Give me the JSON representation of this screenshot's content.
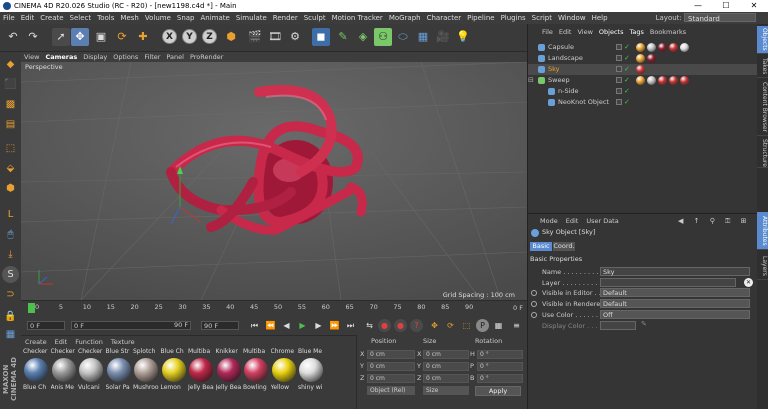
{
  "window": {
    "title": "CINEMA 4D R20.026 Studio (RC - R20) - [new1198.c4d *] - Main",
    "minimize": "—",
    "maximize": "☐",
    "close": "✕"
  },
  "menubar": {
    "items": [
      "File",
      "Edit",
      "Create",
      "Select",
      "Tools",
      "Mesh",
      "Volume",
      "Snap",
      "Animate",
      "Simulate",
      "Render",
      "Sculpt",
      "Motion Tracker",
      "MoGraph",
      "Character",
      "Pipeline",
      "Plugins",
      "Script",
      "Window",
      "Help"
    ],
    "layout_label": "Layout:",
    "layout_value": "Standard"
  },
  "toolbar": {
    "x": "X",
    "y": "Y",
    "z": "Z"
  },
  "viewport": {
    "menu": [
      "View",
      "Cameras",
      "Display",
      "Options",
      "Filter",
      "Panel",
      "ProRender"
    ],
    "camera_label": "Perspective",
    "grid_spacing": "Grid Spacing : 100 cm"
  },
  "timeline": {
    "ticks": [
      "0",
      "5",
      "10",
      "15",
      "20",
      "25",
      "30",
      "35",
      "40",
      "45",
      "50",
      "55",
      "60",
      "65",
      "70",
      "75",
      "80",
      "85",
      "90"
    ],
    "end_label": "0 F",
    "start_field": "0 F",
    "current_field": "0 F",
    "range_end": "90 F",
    "end_field": "90 F"
  },
  "material_manager": {
    "menu": [
      "Create",
      "Edit",
      "Function",
      "Texture"
    ],
    "materials": [
      {
        "name": "Checker",
        "label": "Blue Ch",
        "color": "#5a7fb0"
      },
      {
        "name": "Checker",
        "label": "Anis Me",
        "color": "#9a9a9a"
      },
      {
        "name": "Checker",
        "label": "Vulcani",
        "color": "#c4c4c4"
      },
      {
        "name": "Blue Str",
        "label": "Solar Pa",
        "color": "#7a8fb0"
      },
      {
        "name": "Splotch",
        "label": "Mushroo",
        "color": "#b0a098"
      },
      {
        "name": "Blue Ch",
        "label": "Lemon",
        "color": "#e4d020"
      },
      {
        "name": "Multiba",
        "label": "Jelly Bea",
        "color": "#c02848"
      },
      {
        "name": "Knikker",
        "label": "Jelly Bea",
        "color": "#b02858"
      },
      {
        "name": "Multiba",
        "label": "Bowling",
        "color": "#d04060"
      },
      {
        "name": "Chrome",
        "label": "Yellow",
        "color": "#e8d010"
      },
      {
        "name": "Blue Me",
        "label": "shiny wi",
        "color": "#dedede"
      }
    ]
  },
  "coordinates": {
    "headers": [
      "Position",
      "Size",
      "Rotation"
    ],
    "rows": [
      {
        "axis": "X",
        "pos": "0 cm",
        "size_axis": "X",
        "size": "0 cm",
        "rot_axis": "H",
        "rot": "0 °"
      },
      {
        "axis": "Y",
        "pos": "0 cm",
        "size_axis": "Y",
        "size": "0 cm",
        "rot_axis": "P",
        "rot": "0 °"
      },
      {
        "axis": "Z",
        "pos": "0 cm",
        "size_axis": "Z",
        "size": "0 cm",
        "rot_axis": "B",
        "rot": "0 °"
      }
    ],
    "mode": "Object (Rel)",
    "size_mode": "Size",
    "apply": "Apply"
  },
  "object_manager": {
    "menu": [
      "File",
      "Edit",
      "View",
      "Objects",
      "Tags",
      "Bookmarks"
    ],
    "objects": [
      {
        "name": "Capsule",
        "color": "#6aa0d8",
        "indent": 0
      },
      {
        "name": "Landscape",
        "color": "#6aa0d8",
        "indent": 0
      },
      {
        "name": "Sky",
        "color": "#6aa0d8",
        "indent": 0,
        "selected": true
      },
      {
        "name": "Sweep",
        "color": "#7ac86a",
        "indent": 0
      },
      {
        "name": "n-Side",
        "color": "#6aa0d8",
        "indent": 1
      },
      {
        "name": "NeoKnot Object",
        "color": "#6aa0d8",
        "indent": 1
      }
    ]
  },
  "attributes": {
    "menu": [
      "Mode",
      "Edit",
      "User Data"
    ],
    "object_title": "Sky Object [Sky]",
    "tabs": [
      "Basic",
      "Coord."
    ],
    "section": "Basic Properties",
    "fields": [
      {
        "label": "Name",
        "value": "Sky"
      },
      {
        "label": "Layer",
        "value": ""
      },
      {
        "label": "Visible in Editor",
        "value": "Default"
      },
      {
        "label": "Visible in Renderer",
        "value": "Default"
      },
      {
        "label": "Use Color",
        "value": "Off"
      },
      {
        "label": "Display Color",
        "value": ""
      }
    ]
  },
  "side_tabs": [
    "Objects",
    "Takes",
    "Content Browser",
    "Structure",
    "Attributes",
    "Layers"
  ],
  "colors": {
    "knot": "#c8284a",
    "accent": "#5a8ad0"
  },
  "maxon_label": "MAXON CINEMA 4D"
}
